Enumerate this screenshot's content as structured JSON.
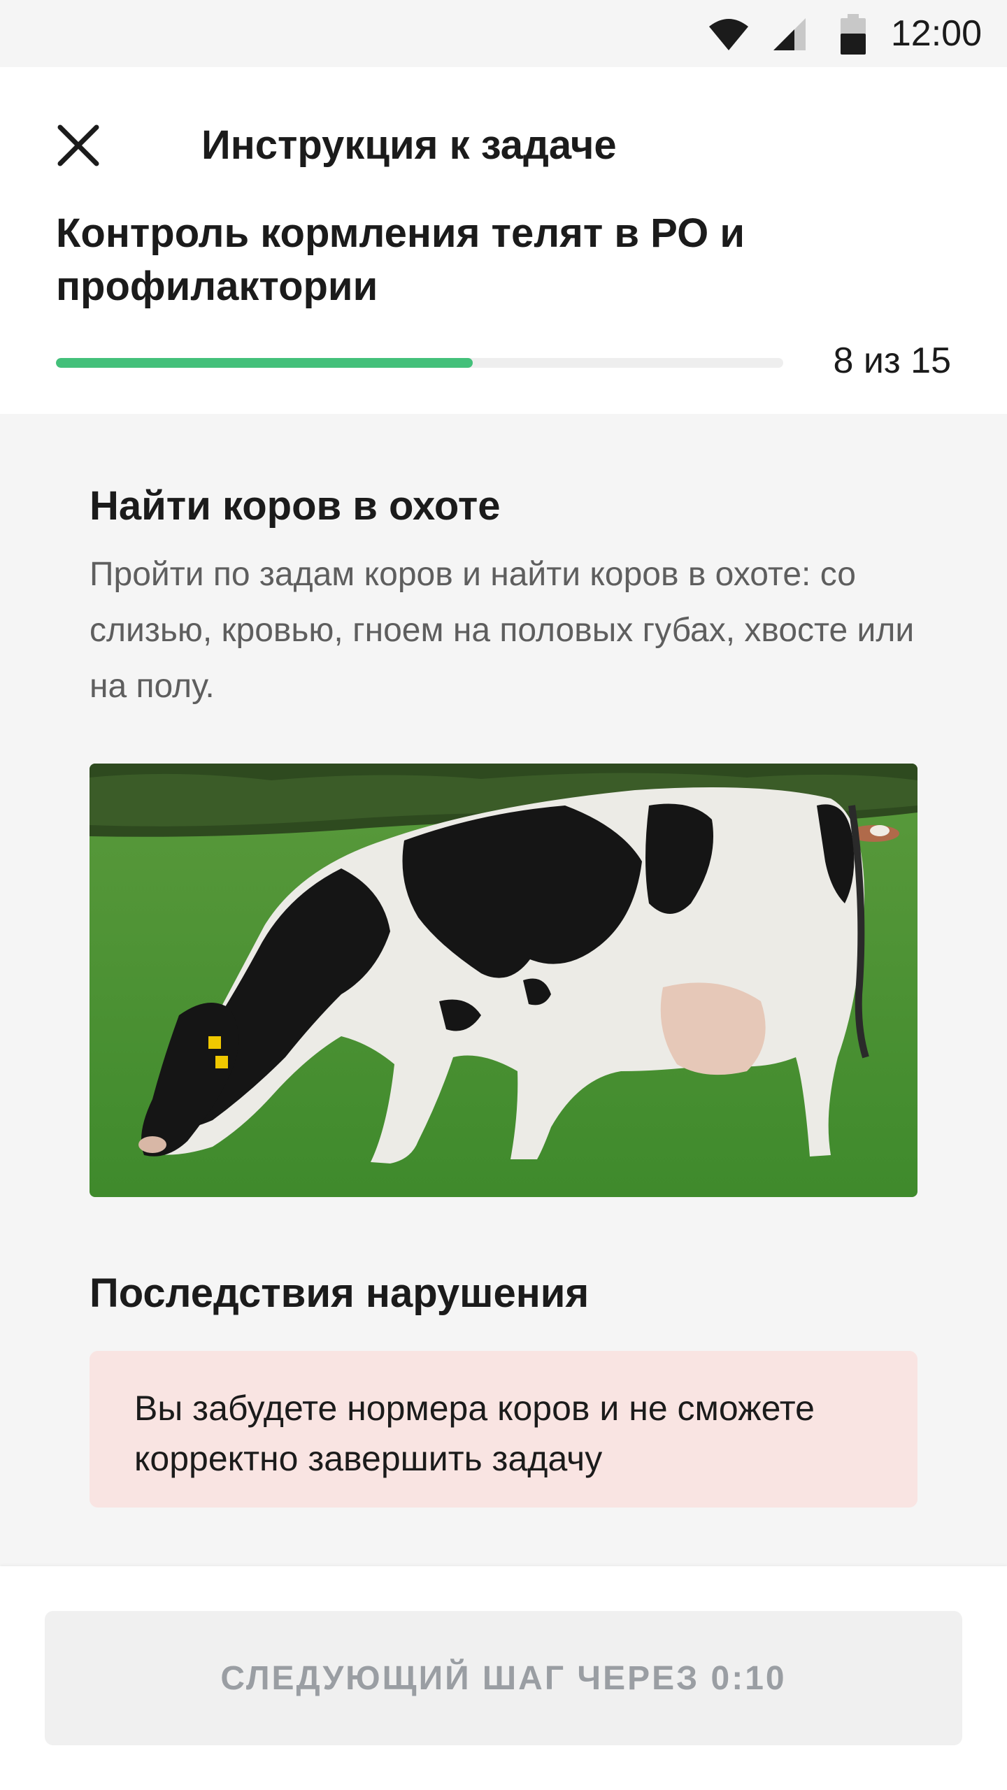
{
  "status_bar": {
    "time": "12:00",
    "icons": [
      "wifi-icon",
      "cellular-signal-icon",
      "battery-icon"
    ]
  },
  "header": {
    "close_icon": "close-icon",
    "title": "Инструкция к задаче",
    "task_title": "Контроль кормления телят в РО и профилактории",
    "progress": {
      "current": 8,
      "total": 15,
      "label": "8 из 15",
      "fraction": 0.5733,
      "color": "#43c07a"
    }
  },
  "step": {
    "title": "Найти коров в охоте",
    "description": "Пройти по задам коров и найти коров в охоте: со слизью, кровью, гноем на половых губах, хвосте или на полу.",
    "image": "holstein-cow-grazing-photo"
  },
  "consequences": {
    "title": "Последствия нарушения",
    "text": "Вы забудете нормера коров и не сможете корректно завершить задачу",
    "background_color": "#f9e4e2"
  },
  "footer": {
    "next_button_label": "СЛЕДУЮЩИЙ ШАГ ЧЕРЕЗ 0:10",
    "next_button_state": "disabled"
  }
}
